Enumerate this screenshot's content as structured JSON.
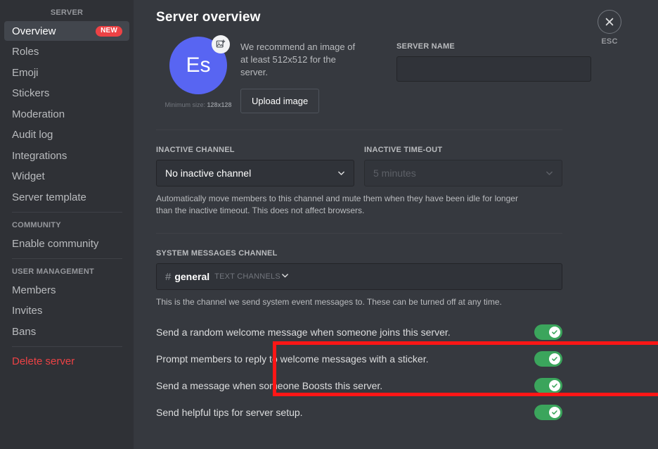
{
  "sidebar": {
    "header": "SERVER",
    "groups": [
      {
        "title": "",
        "items": [
          {
            "label": "Overview",
            "badge": "NEW",
            "active": true
          },
          {
            "label": "Roles"
          },
          {
            "label": "Emoji"
          },
          {
            "label": "Stickers"
          },
          {
            "label": "Moderation"
          },
          {
            "label": "Audit log"
          },
          {
            "label": "Integrations"
          },
          {
            "label": "Widget"
          },
          {
            "label": "Server template"
          }
        ]
      },
      {
        "title": "COMMUNITY",
        "items": [
          {
            "label": "Enable community"
          }
        ]
      },
      {
        "title": "USER MANAGEMENT",
        "items": [
          {
            "label": "Members"
          },
          {
            "label": "Invites"
          },
          {
            "label": "Bans"
          }
        ]
      }
    ],
    "danger_item": "Delete server"
  },
  "header": {
    "title": "Server overview",
    "close_label": "ESC",
    "close_icon": "close-icon"
  },
  "identity": {
    "avatar_initials": "Es",
    "avatar_color": "#5865f2",
    "avatar_badge_icon": "add-image-icon",
    "recommend_text": "We recommend an image of at least 512x512 for the server.",
    "upload_button": "Upload image",
    "min_size_prefix": "Minimum size: ",
    "min_size_value": "128x128",
    "server_name_label": "SERVER NAME",
    "server_name_value": "",
    "server_name_placeholder": ""
  },
  "inactive": {
    "channel_label": "INACTIVE CHANNEL",
    "channel_value": "No inactive channel",
    "timeout_label": "INACTIVE TIME-OUT",
    "timeout_value": "5 minutes",
    "timeout_disabled": true,
    "help_text": "Automatically move members to this channel and mute them when they have been idle for longer than the inactive timeout. This does not affect browsers."
  },
  "system_messages": {
    "label": "SYSTEM MESSAGES CHANNEL",
    "channel_hash": "#",
    "channel_name": "general",
    "channel_category": "TEXT CHANNELS",
    "help_text": "This is the channel we send system event messages to. These can be turned off at any time.",
    "toggles": [
      {
        "label": "Send a random welcome message when someone joins this server.",
        "on": true
      },
      {
        "label": "Prompt members to reply to welcome messages with a sticker.",
        "on": true
      },
      {
        "label": "Send a message when someone Boosts this server.",
        "on": true
      },
      {
        "label": "Send helpful tips for server setup.",
        "on": true
      }
    ]
  },
  "annotation": {
    "highlight_color": "#ff1616"
  }
}
